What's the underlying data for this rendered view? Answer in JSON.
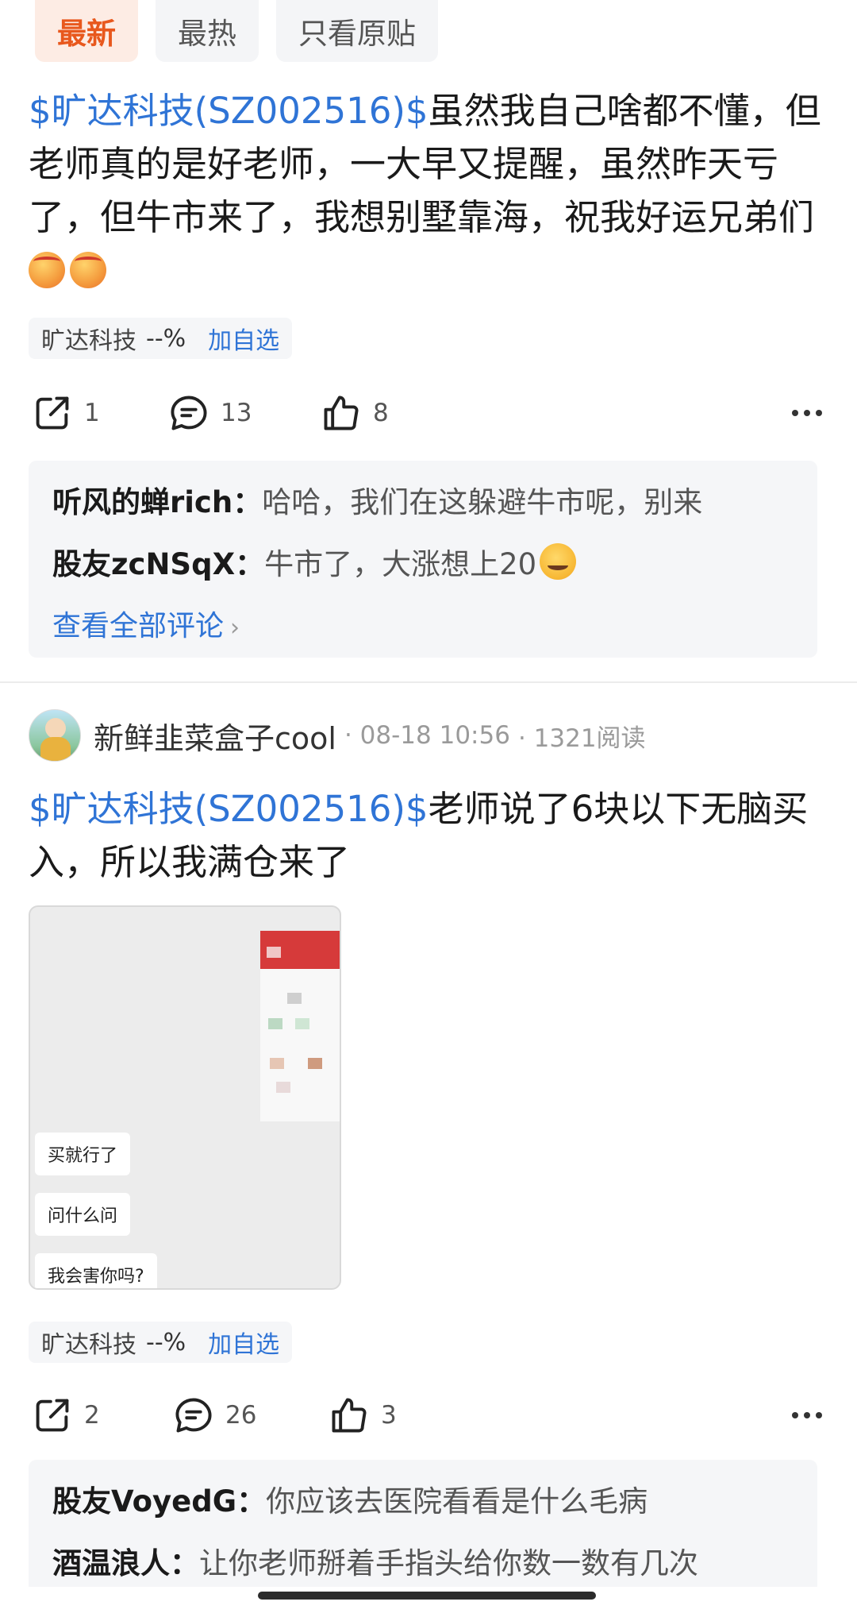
{
  "tabs": [
    {
      "label": "最新",
      "active": true
    },
    {
      "label": "最热",
      "active": false
    },
    {
      "label": "只看原贴",
      "active": false
    }
  ],
  "post1": {
    "cashtag": "$旷达科技(SZ002516)$",
    "text": "虽然我自己啥都不懂，但老师真的是好老师，一大早又提醒，虽然昨天亏了，但牛市来了，我想别墅靠海，祝我好运兄弟们",
    "emojis": [
      "angry-face-emoji",
      "angry-face-emoji"
    ],
    "stock": {
      "name": "旷达科技",
      "pct": "--%",
      "add": "加自选"
    },
    "actions": {
      "share": "1",
      "comment": "13",
      "like": "8"
    },
    "comments": [
      {
        "who": "听风的蝉rich：",
        "text": "哈哈，我们在这躲避牛市呢，别来"
      },
      {
        "who": "股友zcNSqX：",
        "text": "牛市了，大涨想上20"
      }
    ],
    "view_all": "查看全部评论"
  },
  "post2": {
    "author": "新鲜韭菜盒子cool",
    "date": "· 08-18 10:56",
    "reads": "· 1321阅读",
    "cashtag": "$旷达科技(SZ002516)$",
    "text": "老师说了6块以下无脑买入，所以我满仓来了",
    "image_bubbles": [
      "买就行了",
      "问什么问",
      "我会害你吗?"
    ],
    "stock": {
      "name": "旷达科技",
      "pct": "--%",
      "add": "加自选"
    },
    "actions": {
      "share": "2",
      "comment": "26",
      "like": "3"
    },
    "comments": [
      {
        "who": "股友VoyedG：",
        "text": "你应该去医院看看是什么毛病"
      },
      {
        "who": "酒温浪人：",
        "text": "让你老师掰着手指头给你数一数有几次"
      }
    ]
  },
  "colors": {
    "accent": "#e8581d",
    "link": "#2f74d6",
    "chip_bg": "#f5f6f8"
  }
}
